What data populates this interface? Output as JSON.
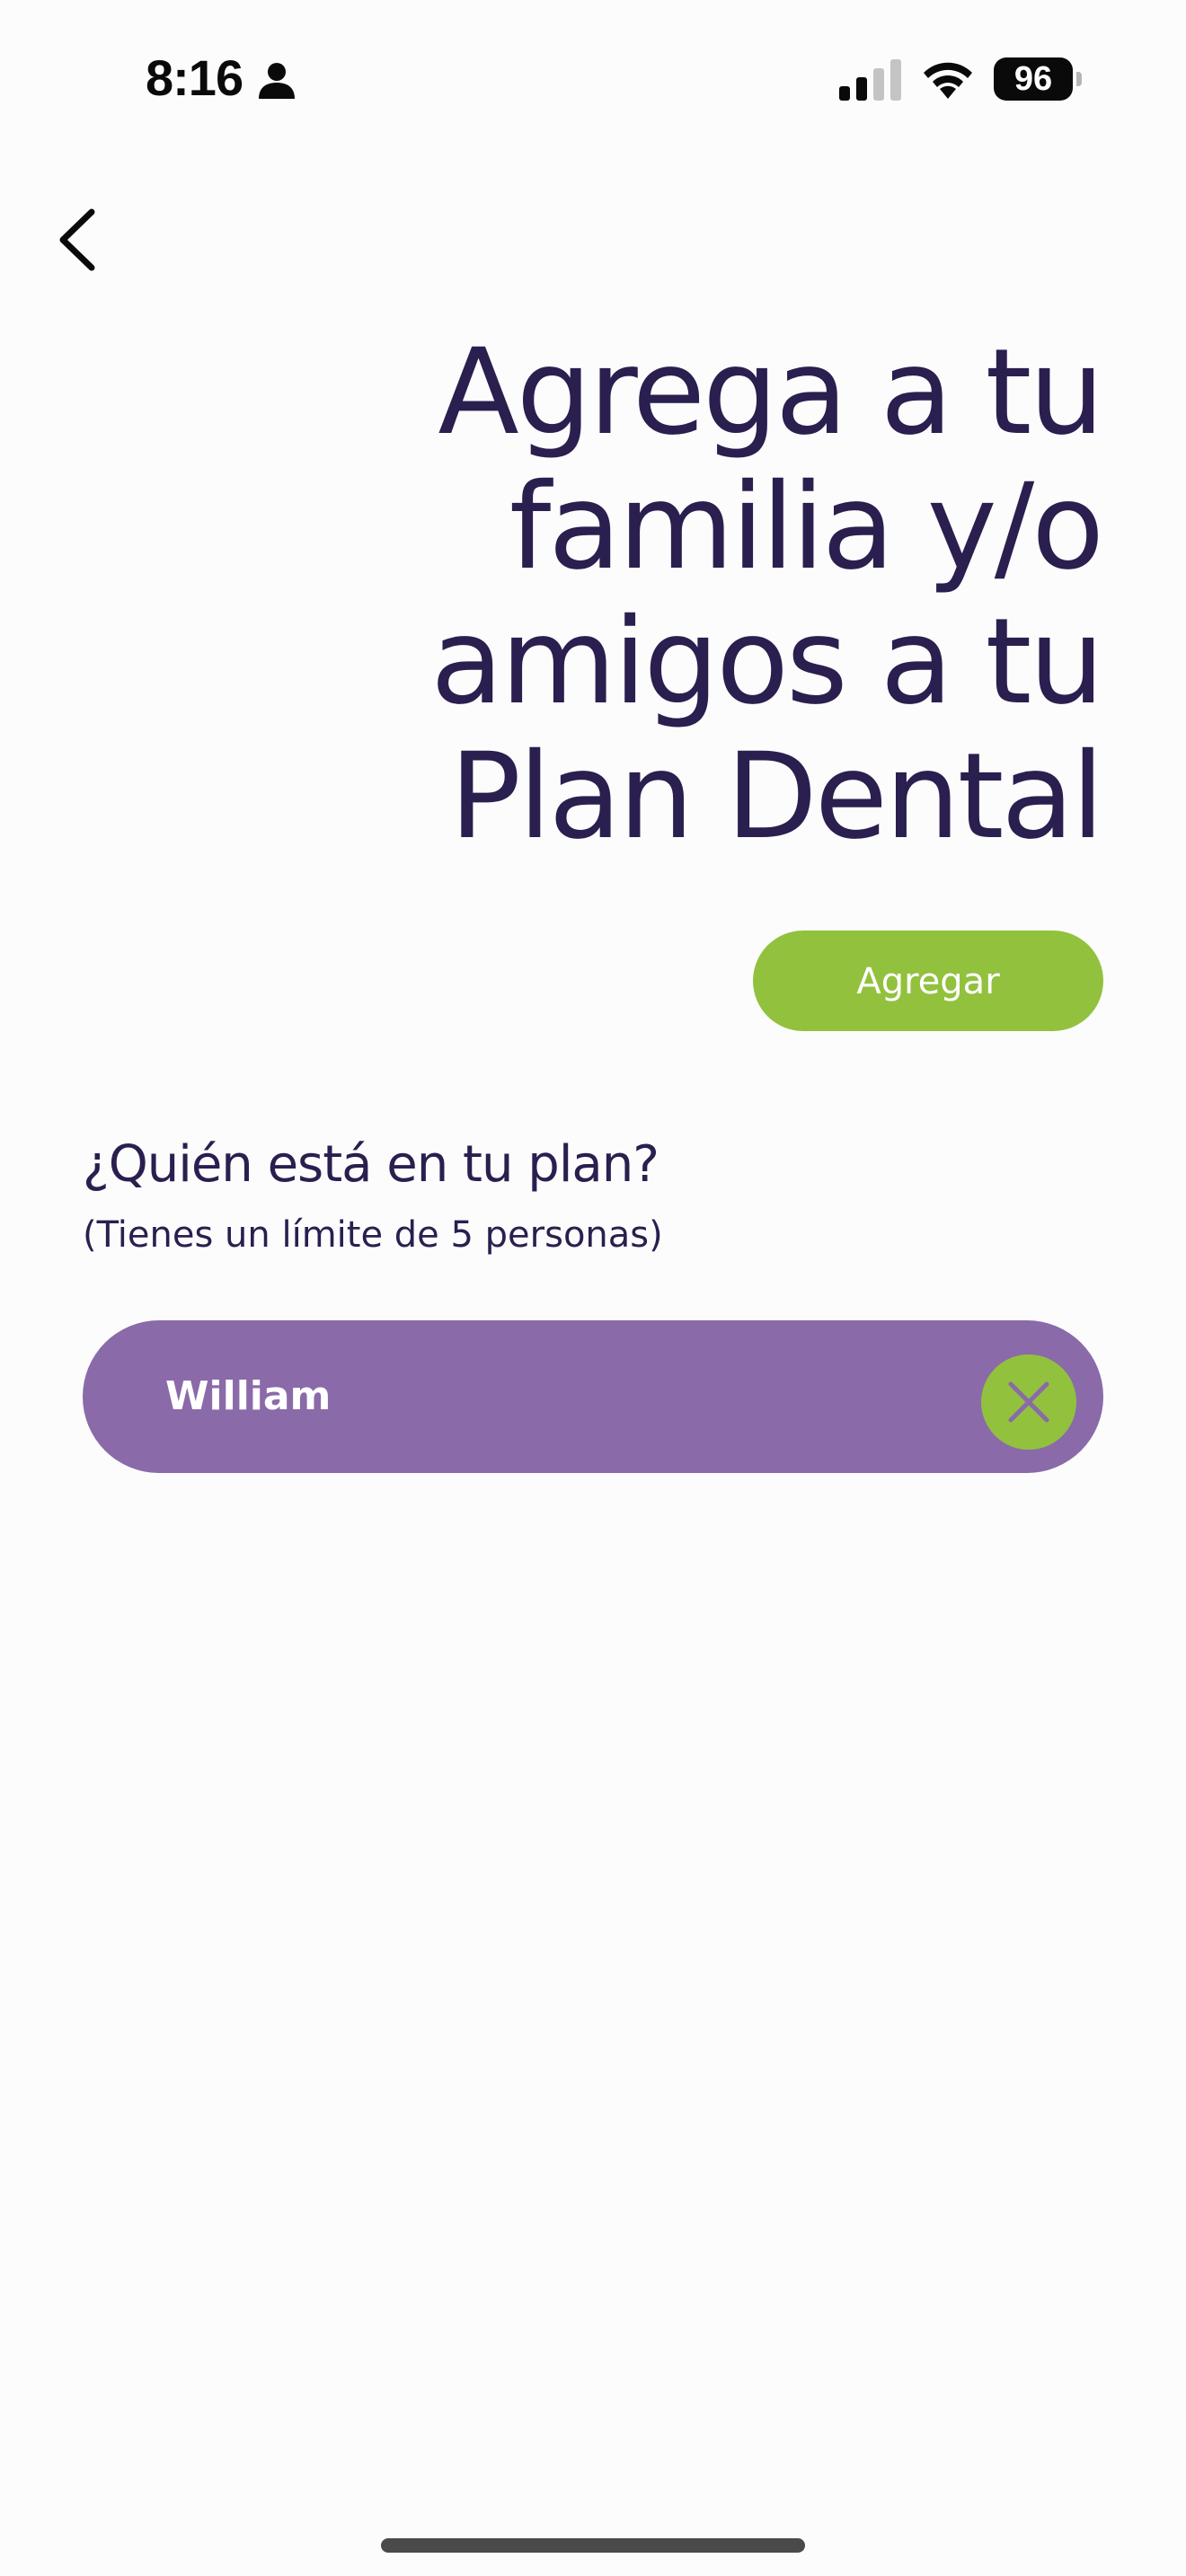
{
  "status_bar": {
    "time": "8:16",
    "battery_level": "96",
    "icons": [
      "person-icon",
      "cellular-signal-icon",
      "wifi-icon",
      "battery-icon"
    ]
  },
  "header": {
    "back_icon": "chevron-left-icon",
    "title": "Agrega a tu\nfamilia y/o\namigos a tu\nPlan Dental"
  },
  "actions": {
    "add_label": "Agregar"
  },
  "members_section": {
    "heading": "¿Quién está en tu plan?",
    "subtext": "(Tienes un límite de 5 personas)",
    "members": [
      {
        "name": "William",
        "remove_icon": "close-icon"
      }
    ]
  },
  "colors": {
    "title": "#2a1f4f",
    "accent_green": "#92c13e",
    "member_purple": "#8a6aa9",
    "background": "#fcfcfc"
  }
}
